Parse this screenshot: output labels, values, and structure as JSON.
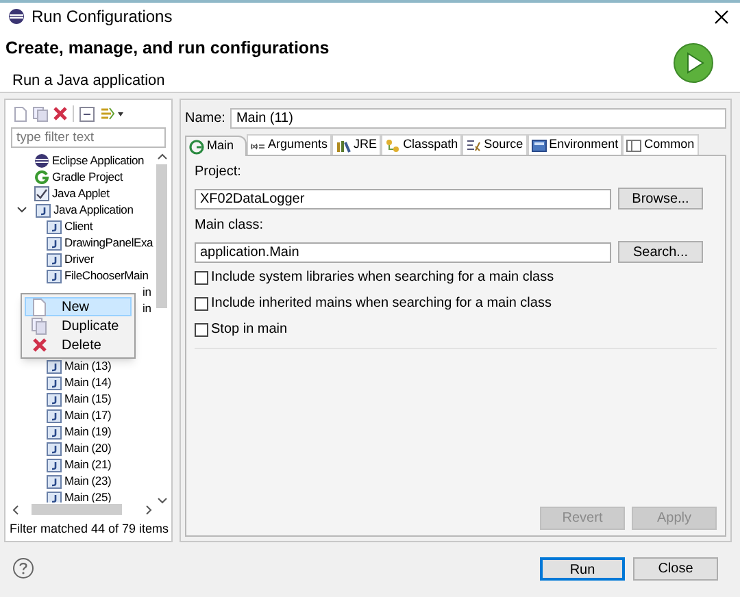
{
  "window": {
    "title": "Run Configurations"
  },
  "header": {
    "title": "Create, manage, and run configurations",
    "subtitle": "Run a Java application"
  },
  "filter": {
    "placeholder": "type filter text"
  },
  "tree": {
    "items": [
      {
        "label": "Eclipse Application",
        "kind": "eclipse"
      },
      {
        "label": "Gradle Project",
        "kind": "gradle"
      },
      {
        "label": "Java Applet",
        "kind": "applet"
      },
      {
        "label": "Java Application",
        "kind": "group",
        "expanded": true,
        "children": [
          {
            "label": "Client",
            "kind": "config"
          },
          {
            "label": "DrawingPanelExa",
            "kind": "config"
          },
          {
            "label": "Driver",
            "kind": "config"
          },
          {
            "label": "FileChooserMain",
            "kind": "config"
          },
          {
            "label": "in",
            "kind": "covered"
          },
          {
            "label": "in",
            "kind": "covered"
          },
          {
            "label": "Main (13)",
            "kind": "config"
          },
          {
            "label": "Main (14)",
            "kind": "config"
          },
          {
            "label": "Main (15)",
            "kind": "config"
          },
          {
            "label": "Main (17)",
            "kind": "config"
          },
          {
            "label": "Main (19)",
            "kind": "config"
          },
          {
            "label": "Main (20)",
            "kind": "config"
          },
          {
            "label": "Main (21)",
            "kind": "config"
          },
          {
            "label": "Main (23)",
            "kind": "config"
          },
          {
            "label": "Main (25)",
            "kind": "config"
          }
        ]
      }
    ]
  },
  "context_menu": [
    {
      "label": "New",
      "selected": true
    },
    {
      "label": "Duplicate",
      "selected": false
    },
    {
      "label": "Delete",
      "selected": false
    }
  ],
  "filter_status": "Filter matched 44 of 79 items",
  "name": {
    "label": "Name:",
    "value": "Main (11)"
  },
  "tabs": [
    {
      "label": "Main",
      "selected": true
    },
    {
      "label": "Arguments",
      "selected": false
    },
    {
      "label": "JRE",
      "selected": false
    },
    {
      "label": "Classpath",
      "selected": false
    },
    {
      "label": "Source",
      "selected": false
    },
    {
      "label": "Environment",
      "selected": false
    },
    {
      "label": "Common",
      "selected": false
    }
  ],
  "project": {
    "label": "Project:",
    "value": "XF02DataLogger",
    "button": "Browse..."
  },
  "main_class": {
    "label": "Main class:",
    "value": "application.Main",
    "button": "Search..."
  },
  "options": [
    {
      "label": "Include system libraries when searching for a main class",
      "checked": false
    },
    {
      "label": "Include inherited mains when searching for a main class",
      "checked": false
    },
    {
      "label": "Stop in main",
      "checked": false
    }
  ],
  "form_buttons": [
    {
      "label": "Revert",
      "disabled": true
    },
    {
      "label": "Apply",
      "disabled": true
    }
  ],
  "dialog_buttons": [
    {
      "label": "Run",
      "default": true
    },
    {
      "label": "Close",
      "default": false
    }
  ]
}
